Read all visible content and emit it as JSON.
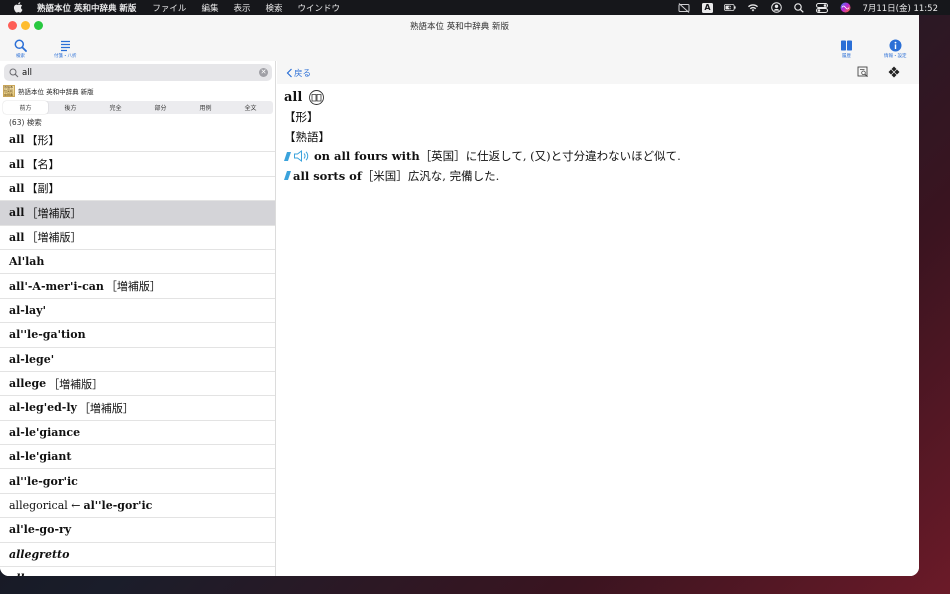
{
  "menubar": {
    "app_name": "熟語本位 英和中辞典 新版",
    "menus": [
      "ファイル",
      "編集",
      "表示",
      "検索",
      "ウインドウ"
    ],
    "input_indicator": "A",
    "clock": "7月11日(金)  11:52"
  },
  "window": {
    "title": "熟語本位 英和中辞典 新版"
  },
  "toolbar": {
    "search_label": "検索",
    "bookmarks_label": "付箋・八折",
    "history_label": "履歴",
    "info_label": "情報・設定"
  },
  "sidebar": {
    "search_value": "all",
    "dictionary_name": "熟語本位 英和中辞典 新版",
    "dictionary_thumb": "熟語本位英和中辞典",
    "search_modes": [
      "前方",
      "後方",
      "完全",
      "部分",
      "用例",
      "全文"
    ],
    "active_mode_index": 0,
    "result_count": "(63) 検索",
    "results": [
      {
        "headword": "all",
        "tag": "【形】",
        "italic": false,
        "selected": false
      },
      {
        "headword": "all",
        "tag": "【名】",
        "italic": false,
        "selected": false
      },
      {
        "headword": "all",
        "tag": "【副】",
        "italic": false,
        "selected": false
      },
      {
        "headword": "all",
        "tag": "［増補版］",
        "italic": false,
        "selected": true
      },
      {
        "headword": "all",
        "tag": "［増補版］",
        "italic": false,
        "selected": false
      },
      {
        "headword": "Al'lah",
        "tag": "",
        "italic": false,
        "selected": false
      },
      {
        "headword": "all'-A-mer'i-can",
        "tag": "［増補版］",
        "italic": false,
        "selected": false
      },
      {
        "headword": "al-lay'",
        "tag": "",
        "italic": false,
        "selected": false
      },
      {
        "headword": "al''le-ga'tion",
        "tag": "",
        "italic": false,
        "selected": false
      },
      {
        "headword": "al-lege'",
        "tag": "",
        "italic": false,
        "selected": false
      },
      {
        "headword": "allege",
        "tag": "［増補版］",
        "italic": false,
        "selected": false
      },
      {
        "headword": "al-leg'ed-ly",
        "tag": "［増補版］",
        "italic": false,
        "selected": false
      },
      {
        "headword": "al-le'giance",
        "tag": "",
        "italic": false,
        "selected": false
      },
      {
        "headword": "al-le'giant",
        "tag": "",
        "italic": false,
        "selected": false
      },
      {
        "headword": "al''le-gor'ic",
        "tag": "",
        "italic": false,
        "selected": false
      },
      {
        "headword": "al''le-gor'ic",
        "prefix": "allegorical ←",
        "tag": "",
        "italic": false,
        "selected": false
      },
      {
        "headword": "al'le-go-ry",
        "tag": "",
        "italic": false,
        "selected": false
      },
      {
        "headword": "allegretto",
        "tag": "",
        "italic": true,
        "selected": false
      },
      {
        "headword": "allegro",
        "tag": "",
        "italic": true,
        "selected": false
      }
    ]
  },
  "detail": {
    "back_label": "戻る",
    "headword": "all",
    "pos": "【形】",
    "section": "【熟語】",
    "idioms": [
      {
        "phrase": "on all fours with",
        "region": "［英国］",
        "definition": "に仕返して, (又)と寸分違わないほど似て.",
        "has_audio": true
      },
      {
        "phrase": "all sorts of",
        "region": "［米国］",
        "definition": "広汎な, 完備した.",
        "has_audio": false
      }
    ]
  },
  "colors": {
    "accent": "#2b6fd6",
    "selected_row": "#d4d4d8",
    "marker": "#3ba3dc"
  }
}
